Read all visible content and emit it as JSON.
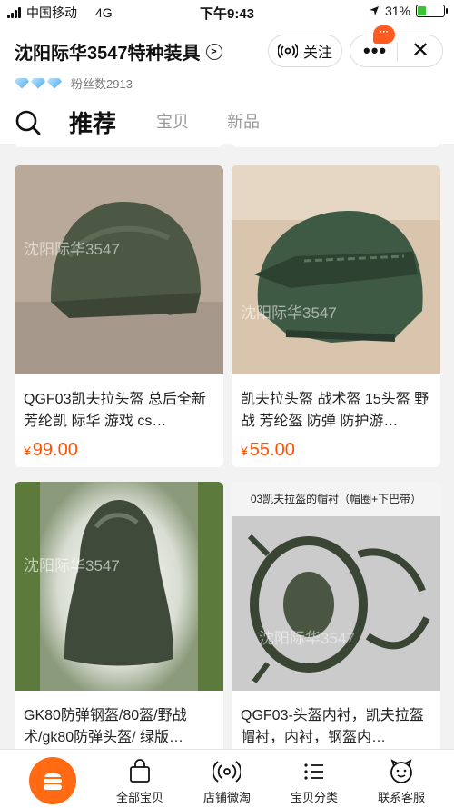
{
  "status": {
    "carrier": "中国移动",
    "network": "4G",
    "time": "下午9:43",
    "battery": "31%",
    "battery_level": 0.31,
    "icons": [
      "signal-icon",
      "location-arrow-icon",
      "battery-icon"
    ]
  },
  "shop": {
    "name": "沈阳际华3547特种装具",
    "fans": "粉丝数2913",
    "follow_label": "关注",
    "message_badge": "···",
    "accent": "#ff6a13"
  },
  "tabs": [
    {
      "label": "推荐",
      "active": true
    },
    {
      "label": "宝贝",
      "active": false
    },
    {
      "label": "新品",
      "active": false
    }
  ],
  "products": [
    {
      "title": "QGF03凯夫拉头盔 总后全新 芳纶凯 际华 游戏 cs…",
      "currency": "¥",
      "price": "99.00",
      "watermark": "沈阳际华3547"
    },
    {
      "title": "凯夫拉头盔 战术盔 15头盔 野战 芳纶盔 防弹 防护游…",
      "currency": "¥",
      "price": "55.00",
      "watermark": "沈阳际华3547"
    },
    {
      "title": "GK80防弹钢盔/80盔/野战术/gk80防弹头盔/ 绿版…",
      "currency": "",
      "price": "",
      "watermark": "沈阳际华3547"
    },
    {
      "title": "QGF03-头盔内衬，凯夫拉盔帽衬，内衬，钢盔内…",
      "currency": "",
      "price": "",
      "caption": "03凯夫拉盔的帽衬（帽圈+下巴带）",
      "watermark": "沈阳际华3547"
    }
  ],
  "bottom_nav": [
    {
      "label": "全部宝贝",
      "icon": "bag-icon"
    },
    {
      "label": "店铺微淘",
      "icon": "broadcast-icon"
    },
    {
      "label": "宝贝分类",
      "icon": "list-icon"
    },
    {
      "label": "联系客服",
      "icon": "service-icon"
    }
  ]
}
